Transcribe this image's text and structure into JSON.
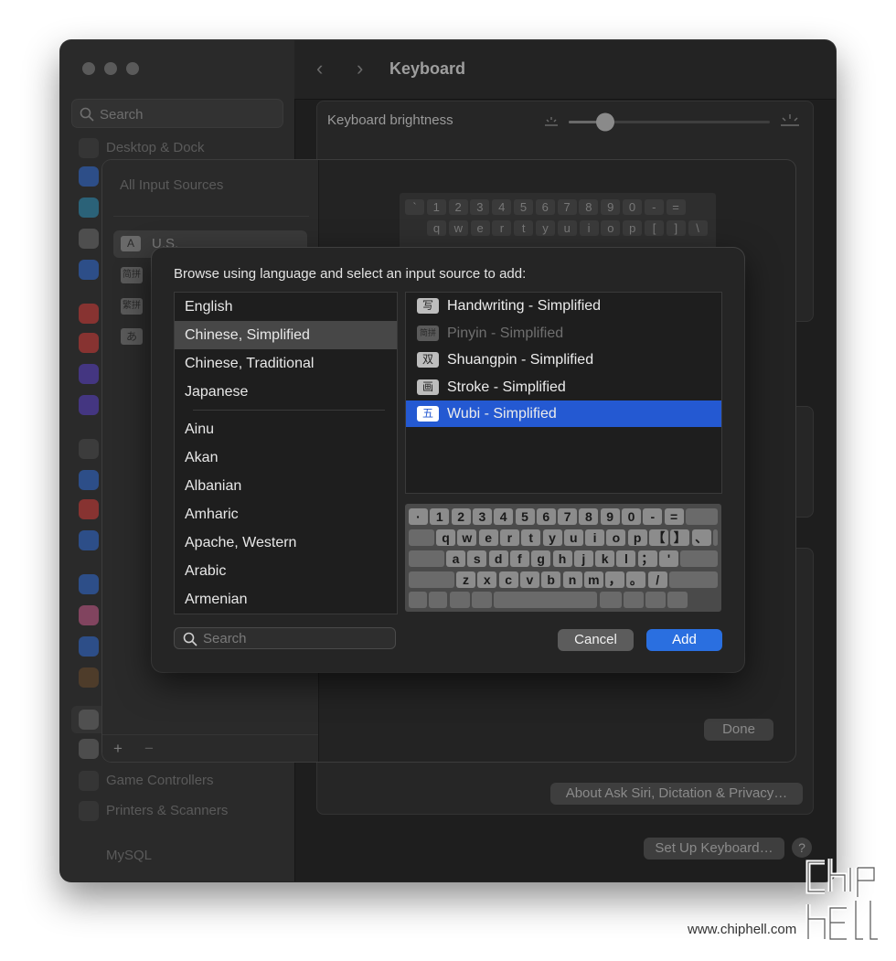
{
  "window": {
    "title": "Keyboard",
    "sidebar": {
      "search_placeholder": "Search",
      "items": [
        "Desktop & Dock",
        "Game Controllers",
        "Printers & Scanners",
        "MySQL"
      ]
    },
    "settings": {
      "brightness_label": "Keyboard brightness",
      "about_button": "About Ask Siri, Dictation & Privacy…",
      "setup_button": "Set Up Keyboard…",
      "help_button": "?"
    }
  },
  "input_sources_sheet": {
    "header": "All Input Sources",
    "sources": [
      {
        "glyph": "A",
        "label": "U.S."
      },
      {
        "glyph": "简拼",
        "label": ""
      },
      {
        "glyph": "繁拼",
        "label": ""
      },
      {
        "glyph": "あ",
        "label": ""
      }
    ],
    "add_symbol": "+",
    "remove_symbol": "−",
    "done_button": "Done",
    "preview_rows": [
      [
        "`",
        "1",
        "2",
        "3",
        "4",
        "5",
        "6",
        "7",
        "8",
        "9",
        "0",
        "-",
        "="
      ],
      [
        "q",
        "w",
        "e",
        "r",
        "t",
        "y",
        "u",
        "i",
        "o",
        "p",
        "[",
        "]",
        "\\"
      ]
    ]
  },
  "dialog": {
    "prompt": "Browse using language and select an input source to add:",
    "languages_top": [
      "English",
      "Chinese, Simplified",
      "Chinese, Traditional",
      "Japanese"
    ],
    "languages": [
      "Ainu",
      "Akan",
      "Albanian",
      "Amharic",
      "Apache, Western",
      "Arabic",
      "Armenian"
    ],
    "selected_language": "Chinese, Simplified",
    "input_sources": [
      {
        "glyph": "写",
        "label": "Handwriting - Simplified",
        "state": "normal"
      },
      {
        "glyph": "简拼",
        "label": "Pinyin - Simplified",
        "state": "disabled"
      },
      {
        "glyph": "双",
        "label": "Shuangpin - Simplified",
        "state": "normal"
      },
      {
        "glyph": "画",
        "label": "Stroke - Simplified",
        "state": "normal"
      },
      {
        "glyph": "五",
        "label": "Wubi - Simplified",
        "state": "selected"
      }
    ],
    "keyboard_rows": [
      [
        "·",
        "1",
        "2",
        "3",
        "4",
        "5",
        "6",
        "7",
        "8",
        "9",
        "0",
        "-",
        "="
      ],
      [
        "q",
        "w",
        "e",
        "r",
        "t",
        "y",
        "u",
        "i",
        "o",
        "p",
        "【",
        "】",
        "、"
      ],
      [
        "a",
        "s",
        "d",
        "f",
        "g",
        "h",
        "j",
        "k",
        "l",
        "；",
        "'"
      ],
      [
        "z",
        "x",
        "c",
        "v",
        "b",
        "n",
        "m",
        "，",
        "。",
        "/"
      ]
    ],
    "search_placeholder": "Search",
    "cancel_button": "Cancel",
    "add_button": "Add",
    "accent_color": "#2459d2"
  },
  "watermark": {
    "url": "www.chiphell.com",
    "logo_text": "chip hell"
  }
}
